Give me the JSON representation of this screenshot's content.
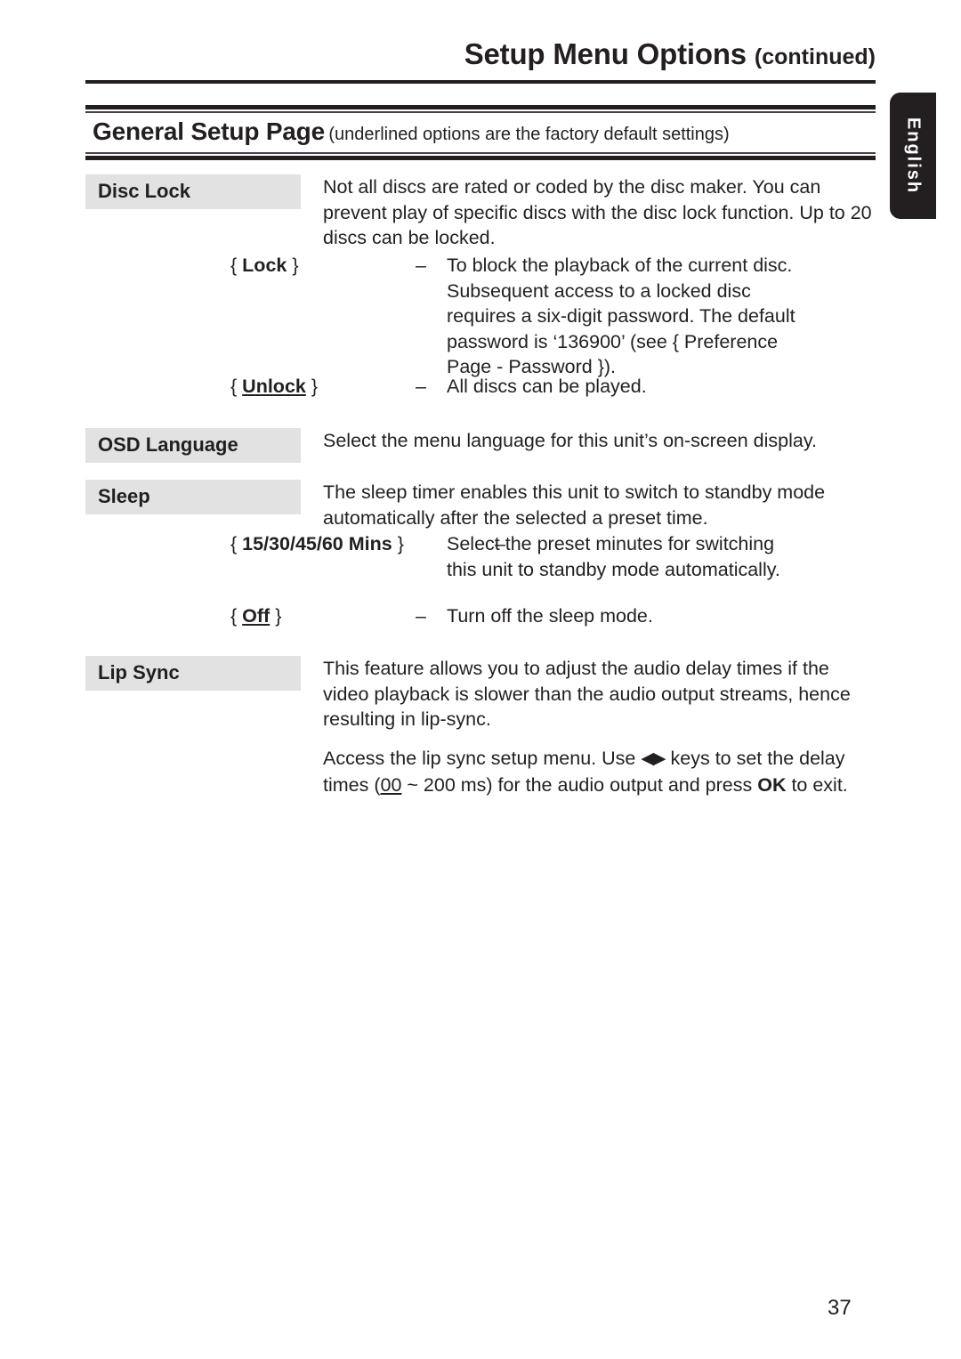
{
  "header": {
    "title": "Setup Menu Options",
    "title_suffix": "(continued)"
  },
  "section": {
    "title": "General Setup Page",
    "note": "(underlined options are the factory default settings)"
  },
  "side_tab": {
    "language": "English"
  },
  "entries": [
    {
      "label": "Disc Lock",
      "paragraphs": [
        "Not all discs are rated or coded by the disc maker. You can prevent play of specific discs with the disc lock function. Up to 20 discs can be locked."
      ],
      "options": [
        {
          "open_brace": "{",
          "name": "Lock",
          "close_brace": "}",
          "bold": true,
          "underlined": false,
          "dash": "–",
          "description": "To block the playback of the current disc. Subsequent access to a locked disc requires a six-digit password. The default password is ‘136900’ (see { Preference Page - Password })."
        },
        {
          "open_brace": "{",
          "name": "Unlock",
          "close_brace": "}",
          "bold": true,
          "underlined": true,
          "dash": "–",
          "description": "All discs can be played."
        }
      ]
    },
    {
      "label": "OSD Language",
      "paragraphs": [
        "Select the menu language for this unit’s on-screen display."
      ],
      "options": []
    },
    {
      "label": "Sleep",
      "paragraphs": [
        "The sleep timer enables this unit to switch to standby mode automatically after the selected a preset time."
      ],
      "options": [
        {
          "open_brace": "{",
          "name": "15/30/45/60 Mins",
          "close_brace": "}",
          "bold": true,
          "underlined": false,
          "dash": "–",
          "description": "Select the preset minutes for switching this unit to standby mode automatically."
        },
        {
          "open_brace": "{",
          "name": "Off",
          "close_brace": "}",
          "bold": true,
          "underlined": true,
          "dash": "–",
          "description": "Turn off the sleep mode."
        }
      ]
    },
    {
      "label": "Lip Sync",
      "paragraphs": [
        "This feature allows you to adjust the audio delay times if the video playback is slower than the audio output streams, hence resulting in lip-sync."
      ],
      "options": [],
      "extra": {
        "lead": "Access the lip sync setup menu. Use ",
        "arrows": "◀▶",
        "mid": " keys to set the delay times (",
        "default_value": "00",
        "tail_a": " ~ 200 ms) for the audio output and press ",
        "ok_key": "OK",
        "tail_b": " to exit."
      }
    }
  ],
  "footer": {
    "page_number": "37"
  }
}
